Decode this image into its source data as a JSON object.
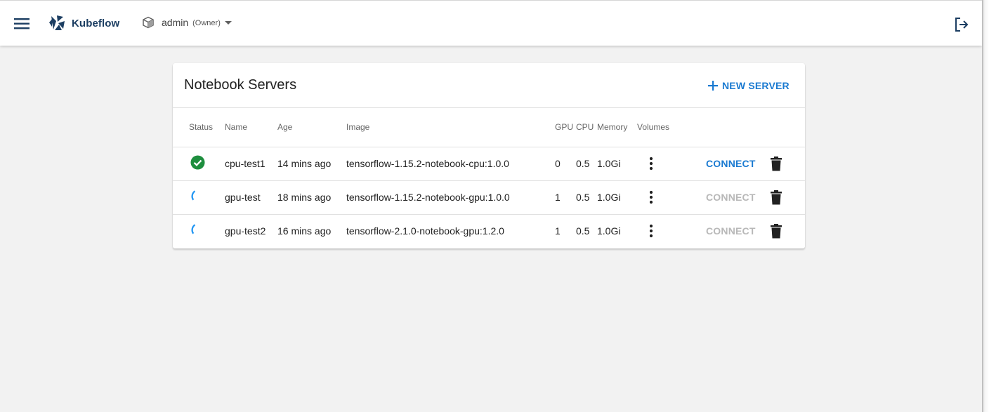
{
  "header": {
    "app_name": "Kubeflow",
    "namespace": "admin",
    "role": "(Owner)",
    "icons": {
      "menu": "menu-icon",
      "logo": "kubeflow-logo",
      "namespace": "cube-icon",
      "dropdown": "caret-down-icon",
      "logout": "logout-icon"
    }
  },
  "card": {
    "title": "Notebook Servers",
    "new_server_label": "NEW SERVER",
    "columns": [
      "Status",
      "Name",
      "Age",
      "Image",
      "GPU",
      "CPU",
      "Memory",
      "Volumes"
    ],
    "rows": [
      {
        "status": "ready",
        "name": "cpu-test1",
        "age": "14 mins ago",
        "image": "tensorflow-1.15.2-notebook-cpu:1.0.0",
        "gpu": "0",
        "cpu": "0.5",
        "memory": "1.0Gi",
        "connect": "CONNECT",
        "connect_enabled": true
      },
      {
        "status": "waiting",
        "name": "gpu-test",
        "age": "18 mins ago",
        "image": "tensorflow-1.15.2-notebook-gpu:1.0.0",
        "gpu": "1",
        "cpu": "0.5",
        "memory": "1.0Gi",
        "connect": "CONNECT",
        "connect_enabled": false
      },
      {
        "status": "waiting",
        "name": "gpu-test2",
        "age": "16 mins ago",
        "image": "tensorflow-2.1.0-notebook-gpu:1.2.0",
        "gpu": "1",
        "cpu": "0.5",
        "memory": "1.0Gi",
        "connect": "CONNECT",
        "connect_enabled": false
      }
    ]
  },
  "colors": {
    "accent": "#1a7ad1",
    "ready": "#1e8e3e",
    "spinner": "#2196f3",
    "brand": "#1c3e62",
    "disabled": "#b8b8b8"
  }
}
